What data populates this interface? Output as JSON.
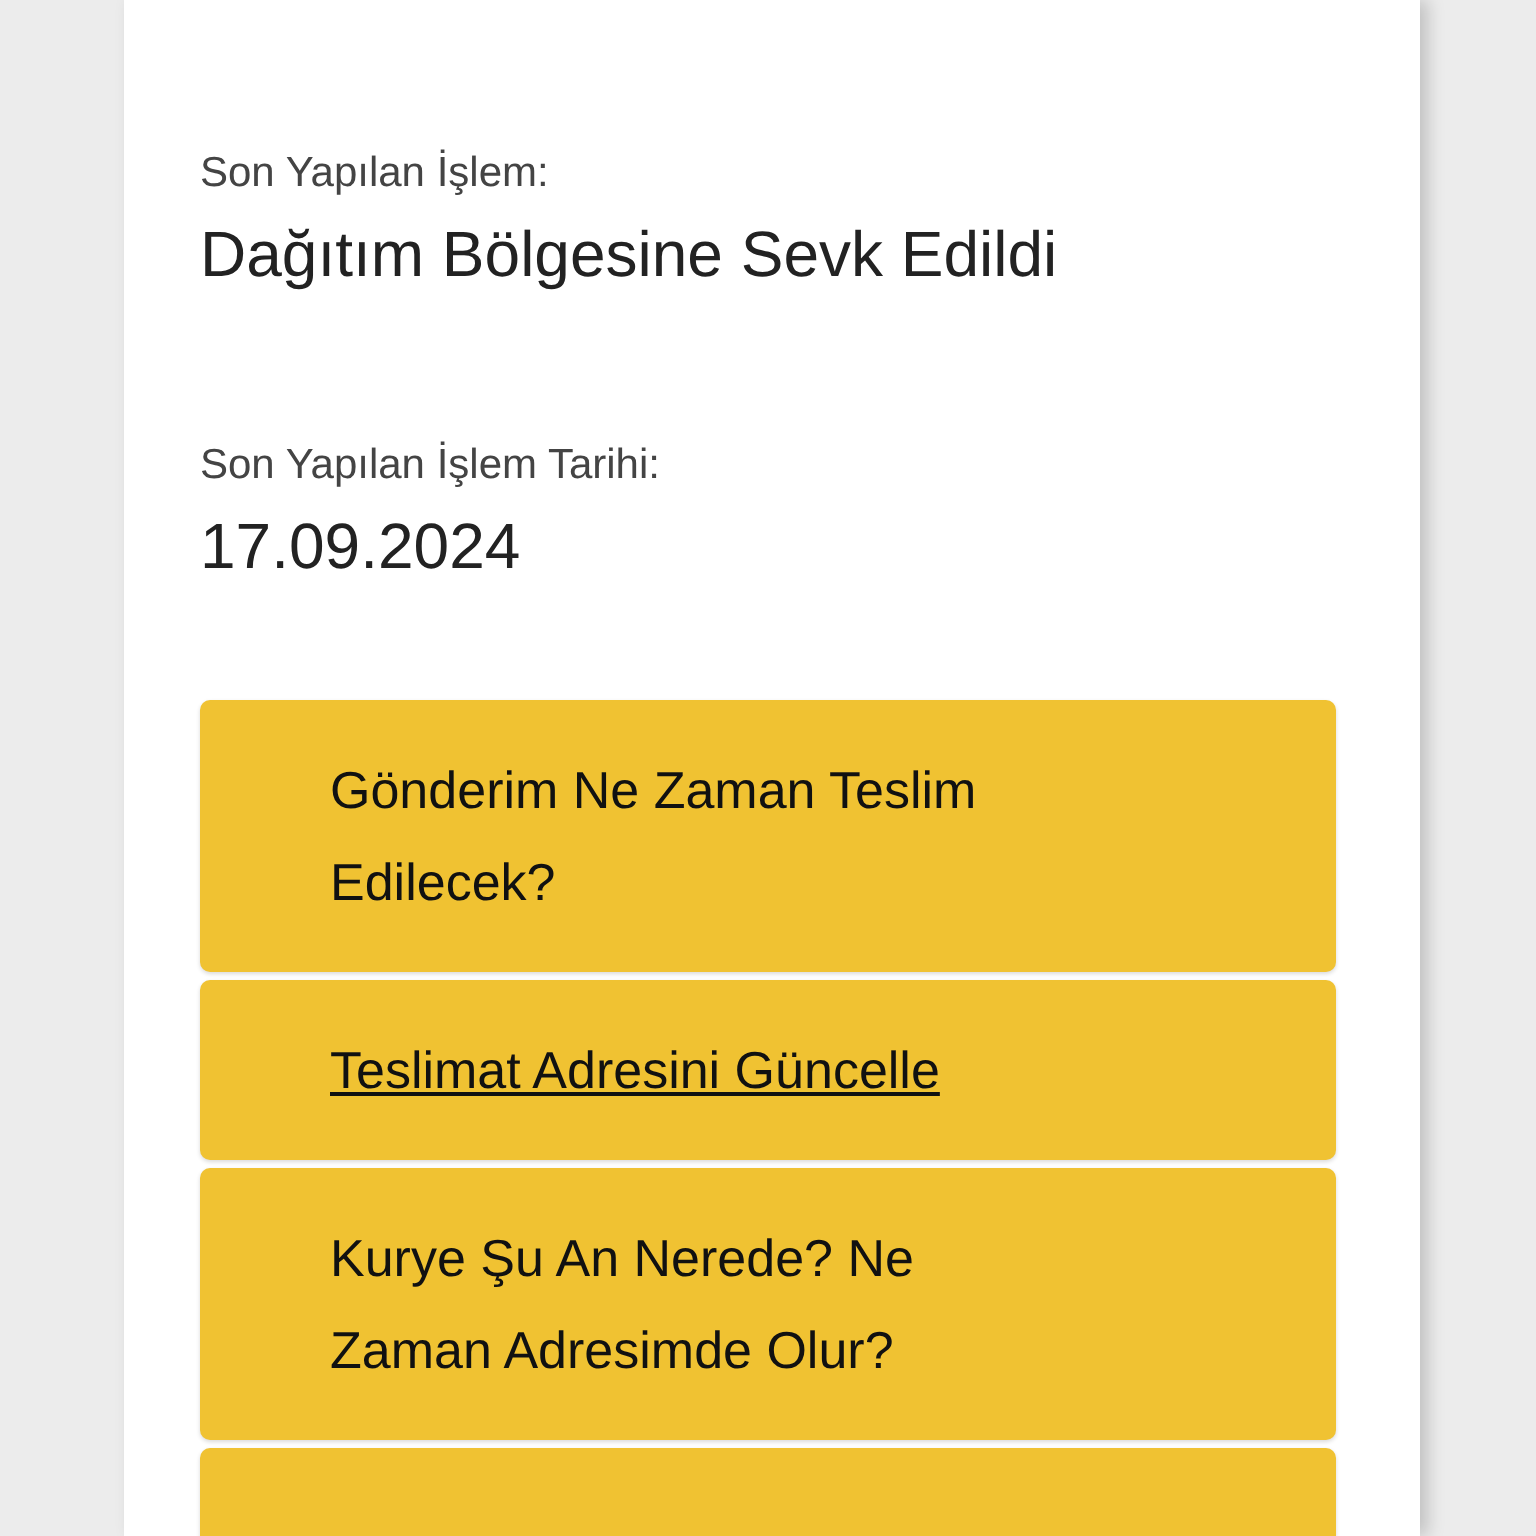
{
  "fields": [
    {
      "label": "Son Yapılan İşlem:",
      "value": "Dağıtım Bölgesine Sevk Edildi"
    },
    {
      "label": "Son Yapılan İşlem Tarihi:",
      "value": "17.09.2024"
    }
  ],
  "options": [
    {
      "label": "Gönderim Ne Zaman Teslim Edilecek?",
      "underlined": false
    },
    {
      "label": "Teslimat Adresini Güncelle",
      "underlined": true
    },
    {
      "label": "Kurye Şu An Nerede? Ne Zaman Adresimde Olur?",
      "underlined": false
    },
    {
      "kind": "blank"
    }
  ]
}
